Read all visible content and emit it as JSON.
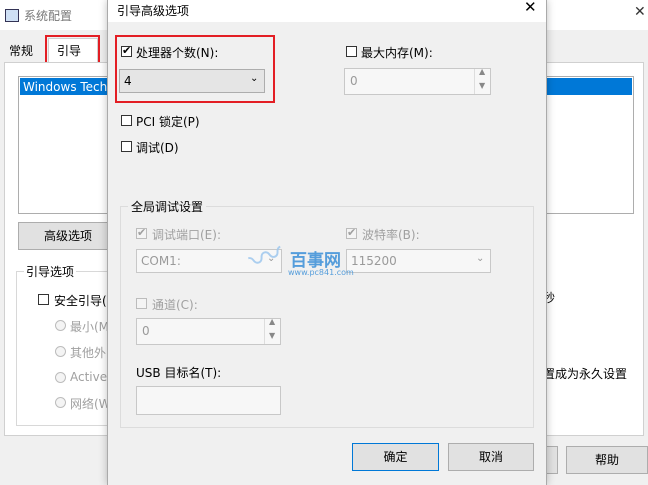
{
  "back_window": {
    "title": "系统配置",
    "tabs": [
      "常规",
      "引导"
    ],
    "list_item": "Windows Tech",
    "advanced_button": "高级选项",
    "boot_options_label": "引导选项",
    "safe_boot": "安全引导(",
    "radio_options": [
      "最小(M",
      "其他外",
      "Active",
      "网络(W"
    ],
    "right_text_1": "秒",
    "right_text_2": "置成为永久设置",
    "help_button": "帮助",
    "close_glyph": "✕"
  },
  "dialog": {
    "title": "引导高级选项",
    "close_glyph": "✕",
    "num_processors_label": "处理器个数(N):",
    "num_processors_value": "4",
    "max_memory_label": "最大内存(M):",
    "max_memory_value": "0",
    "pci_lock_label": "PCI 锁定(P)",
    "debug_label": "调试(D)",
    "global_debug_group": "全局调试设置",
    "debug_port_label": "调试端口(E):",
    "debug_port_value": "COM1:",
    "baud_rate_label": "波特率(B):",
    "baud_rate_value": "115200",
    "channel_label": "通道(C):",
    "channel_value": "0",
    "usb_target_label": "USB 目标名(T):",
    "usb_target_value": "",
    "ok_button": "确定",
    "cancel_button": "取消"
  },
  "watermark": {
    "text": "百事网",
    "url": "www.pc841.com"
  },
  "colors": {
    "highlight_red": "#e31e24",
    "selection_blue": "#0078d7",
    "dialog_bg": "#f0f0f0",
    "watermark_blue": "#3a8fd8"
  }
}
